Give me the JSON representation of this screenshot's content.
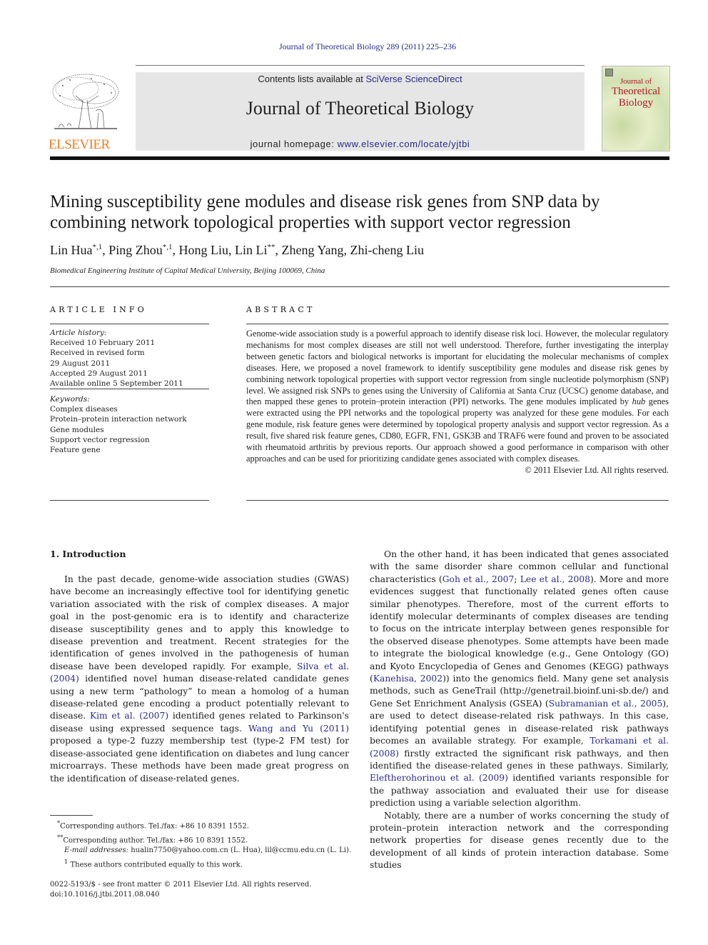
{
  "header": {
    "citation": "Journal of Theoretical Biology 289 (2011) 225–236",
    "contents_prefix": "Contents lists available at ",
    "contents_link": "SciVerse ScienceDirect",
    "journal_title": "Journal of Theoretical Biology",
    "homepage_prefix": "journal homepage: ",
    "homepage_link": "www.elsevier.com/locate/yjtbi",
    "publisher_logo_text": "ELSEVIER",
    "cover": {
      "line1": "Journal of",
      "line2": "Theoretical",
      "line3": "Biology"
    },
    "colors": {
      "link": "#2a2a8c",
      "elsevier_orange": "#f07b1e",
      "cover_red": "#b3162a",
      "banner_bg": "#e6e6e6"
    }
  },
  "article": {
    "title_line1": "Mining susceptibility gene modules and disease risk genes from SNP data by",
    "title_line2": "combining network topological properties with support vector regression",
    "authors": [
      {
        "name": "Lin Hua",
        "marks": "*,1",
        "sep": ", "
      },
      {
        "name": "Ping Zhou",
        "marks": "*,1",
        "sep": ", "
      },
      {
        "name": "Hong Liu",
        "marks": "",
        "sep": ", "
      },
      {
        "name": "Lin Li",
        "marks": "**",
        "sep": ", "
      },
      {
        "name": "Zheng Yang",
        "marks": "",
        "sep": ", "
      },
      {
        "name": "Zhi-cheng Liu",
        "marks": "",
        "sep": ""
      }
    ],
    "affiliation": "Biomedical Engineering Institute of Capital Medical University, Beijing 100069, China"
  },
  "article_info": {
    "heading": "ARTICLE INFO",
    "history_label": "Article history:",
    "history": [
      "Received 10 February 2011",
      "Received in revised form",
      "29 August 2011",
      "Accepted 29 August 2011",
      "Available online 5 September 2011"
    ],
    "keywords_label": "Keywords:",
    "keywords": [
      "Complex diseases",
      "Protein–protein interaction network",
      "Gene modules",
      "Support vector regression",
      "Feature gene"
    ]
  },
  "abstract": {
    "heading": "ABSTRACT",
    "text_part1": "Genome-wide association study is a powerful approach to identify disease risk loci. However, the molecular regulatory mechanisms for most complex diseases are still not well understood. Therefore, further investigating the interplay between genetic factors and biological networks is important for elucidating the molecular mechanisms of complex diseases. Here, we proposed a novel framework to identify susceptibility gene modules and disease risk genes by combining network topological properties with support vector regression from single nucleotide polymorphism (SNP) level. We assigned risk SNPs to genes using the University of California at Santa Cruz (UCSC) genome database, and then mapped these genes to protein–protein interaction (PPI) networks. The gene modules implicated by ",
    "text_italic": "hub",
    "text_part2": " genes were extracted using the PPI networks and the topological property was analyzed for these gene modules. For each gene module, risk feature genes were determined by topological property analysis and support vector regression. As a result, five shared risk feature genes, CD80, EGFR, FN1, GSK3B and TRAF6 were found and proven to be associated with rheumatoid arthritis by previous reports. Our approach showed a good performance in comparison with other approaches and can be used for prioritizing candidate genes associated with complex diseases.",
    "copyright": "© 2011 Elsevier Ltd. All rights reserved."
  },
  "introduction": {
    "heading": "1.  Introduction",
    "left_p1": [
      {
        "t": "In the past decade, genome-wide association studies (GWAS) have become an increasingly effective tool for identifying genetic variation associated with the risk of complex diseases. A major goal in the post-genomic era is to identify and characterize disease susceptibility genes and to apply this knowledge to disease prevention and treatment. Recent strategies for the identification of genes involved in the pathogenesis of human disease have been developed rapidly. For example, "
      },
      {
        "t": "Silva et al. (2004)",
        "link": true
      },
      {
        "t": " identified novel human disease-related candidate genes using a new term “pathology” to mean a homolog of a human disease-related gene encoding a product potentially relevant to disease. "
      },
      {
        "t": "Kim et al. (2007)",
        "link": true
      },
      {
        "t": " identified genes related to Parkinson's disease using expressed sequence tags. "
      },
      {
        "t": "Wang and Yu (2011)",
        "link": true
      },
      {
        "t": " proposed a type-2 fuzzy membership test (type-2 FM test) for disease-associated gene identification on diabetes and lung cancer microarrays. These methods have been made great progress on the identification of disease-related genes."
      }
    ],
    "right_p1": [
      {
        "t": "On the other hand, it has been indicated that genes associated with the same disorder share common cellular and functional characteristics ("
      },
      {
        "t": "Goh et al., 2007",
        "link": true
      },
      {
        "t": "; "
      },
      {
        "t": "Lee et al., 2008",
        "link": true
      },
      {
        "t": "). More and more evidences suggest that functionally related genes often cause similar phenotypes. Therefore, most of the current efforts to identify molecular determinants of complex diseases are tending to focus on the intricate interplay between genes responsible for the observed disease phenotypes. Some attempts have been made to integrate the biological knowledge (e.g., Gene Ontology (GO) and Kyoto Encyclopedia of Genes and Genomes (KEGG) pathways ("
      },
      {
        "t": "Kanehisa, 2002",
        "link": true
      },
      {
        "t": ")) into the genomics field. Many gene set analysis methods, such as GeneTrail (http://genetrail.bioinf.uni-sb.de/) and Gene Set Enrichment Analysis (GSEA) ("
      },
      {
        "t": "Subramanian et al., 2005",
        "link": true
      },
      {
        "t": "), are used to detect disease-related risk pathways. In this case, identifying potential genes in disease-related risk pathways becomes an available strategy. For example, "
      },
      {
        "t": "Torkamani et al. (2008)",
        "link": true
      },
      {
        "t": " firstly extracted the significant risk pathways, and then identified the disease-related genes in these pathways. Similarly, "
      },
      {
        "t": "Eleftherohorinou et al. (2009)",
        "link": true
      },
      {
        "t": " identified variants responsible for the pathway association and evaluated their use for disease prediction using a variable selection algorithm."
      }
    ],
    "right_p2": [
      {
        "t": "Notably, there are a number of works concerning the study of protein–protein interaction network and the corresponding network properties for disease genes recently due to the development of all kinds of protein interaction database. Some studies"
      }
    ]
  },
  "footnotes": {
    "fn1_mark": "*",
    "fn1": "Corresponding authors. Tel./fax: +86 10 8391 1552.",
    "fn2_mark": "**",
    "fn2": "Corresponding author. Tel./fax: +86 10 8391 1552.",
    "email_label": "E-mail addresses:",
    "emails": "hualin7750@yahoo.com.cn (L. Hua), lil@ccmu.edu.cn (L. Li).",
    "fn3_mark": "1",
    "fn3": "These authors contributed equally to this work.",
    "issn": "0022-5193/$ - see front matter © 2011 Elsevier Ltd. All rights reserved.",
    "doi": "doi:10.1016/j.jtbi.2011.08.040"
  }
}
